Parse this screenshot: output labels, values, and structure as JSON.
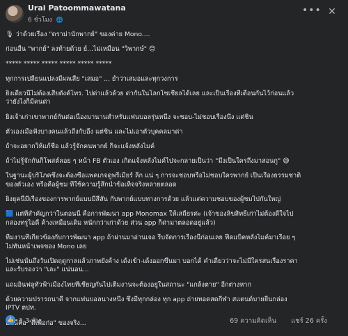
{
  "post": {
    "author": "Urai Patoommawatana",
    "time": "6 ชั่วโมง",
    "privacy_icon": "globe-icon",
    "more_icon": "more-icon",
    "close_icon": "close-icon",
    "lines": [
      "🎙 ว่าด้วยเรื่อง \"ดราม่านักพากย์\" ของค่าย Mono....",
      "ก่อนอื่น \"พากย์\" ลงท้ายด้วย ย์...ไม่เหมือน \"วิพากษ์\" 😊",
      "***** ***** ***** ***** ***** *****",
      "ทุกการเปลี่ยนแปลงมีผลเสีย \"เสมอ\" ... ย้ำว่าเสมอและทุกวงการ",
      "ยิ่งเดี๋ยวนี้ไม่ต้องเสียตังค์โทร. ไปด่าแล้วด้วย ด่ากันในโลกโซเชียลได้เลย และเป็นเรื่องที่เตือนกันไว้ก่อนแล้ว",
      "ว่ายังไงก็มีคนด่า",
      "ยิ่งเจ้าเก่าเขาพากย์กันต่อเนื่องมานานสำหรับแฟนบอลรุ่นหนึ่ง จะชอบ-ไม่ชอบเรื่องนึง แต่ชิน",
      "ตัวเองเมื่อฟังบางคนแล้วถึงกับอึ้ง แต่ชิน และไม่เอาตัวบุคคลมาด่า",
      "ถ้าจะอยากให้แก้ชื่อ แล้วรู้จักคนพากย์ ก็จะแจ้งหลังไมค์",
      "ถ้าไม่รู้จักกันก็โพสต์ลอย ๆ หน้า FB ตัวเอง เกิดแจ้งหลังไมค์ไปจะกลายเป็นว่า \"มึงเป็นใครถึงมาสอนกู\" 😅",
      "ในฐานะผู้บริโภคซึ่งจะต้องซื้อแพคเกจดูพรีเมียร์ ลีก แน่ ๆ การจะชอบหรือไม่ชอบใครพากย์ เป็นเรื่องธรรมชาติ",
      "ของตัวเอง หรือคือผู้ชม ที่ใช้ความรู้สึกนำข้อเท็จจริงหลายตลอด",
      "ยิ่งยุคนี้มีเรื่องของการพากย์แบบมีสีสัน กับพากย์แบบทางการด้วย แล้วแต่ความชอบของผู้ชมไปกันใหญ่",
      "🟦 แต่ที่สำคัญกว่าในตอนนี้ คือการพัฒนา app Monomax ให้เสถียรค่ะ (เจ้าของลิขสิทธิ์เก่าไม่ต้องดีใจไป",
      "กล่องทรูไอดี ค้างเหมือนเดิม หนักกว่าเก่าด้วย ส่วน app ก็ด่ามาตลอดอยู่แล้ว)",
      "ทีมงานที่เกี่ยวข้องกับการพัฒนา app ถ้าผ่านมาอ่านเจอ รีบจัดการเรื่องนี้ก่อนเลย ฟีดแบ็คหลังไมค์มาเรื่อย ๆ",
      "ไม่ทันหน้าเพจของ Mono เลย",
      "ไม่เช่นนั้นถึงวันเปิดฤดูกาลแล้วภาพยังค้าง เด้งเข้า-เด้งออกขึ้นมา บอกได้ คำเดียวว่าจะไม่มีใครสนเรื่องราคา",
      "และรับรองว่า \"เละ\" แน่นอน...",
      "แถมอินฟลูทั่วฟ้าเมืองไทยที่เชี่ยญกันไปเต็มงานจะต้องอยู่ในสถานะ \"แกล้งตาย\" อีกต่างหาก",
      "ด้วยความปรารถนาดี จากแฟนบอลนางหนึ่ง ซึ่งมีทุกกล่อง ทุก app ถ่ายทอดสดกีฬา สแตนด์บายยืนกล่อง",
      "IPTV ตปท.",
      "อันนี้คือ \"ดีเพื่อก่อ\" ของจริง..."
    ],
    "reactions_icon": "like-icon",
    "reactions_count": "1.3 พัน",
    "comments": "69 ความคิดเห็น",
    "shares": "แชร์ 26 ครั้ง"
  }
}
